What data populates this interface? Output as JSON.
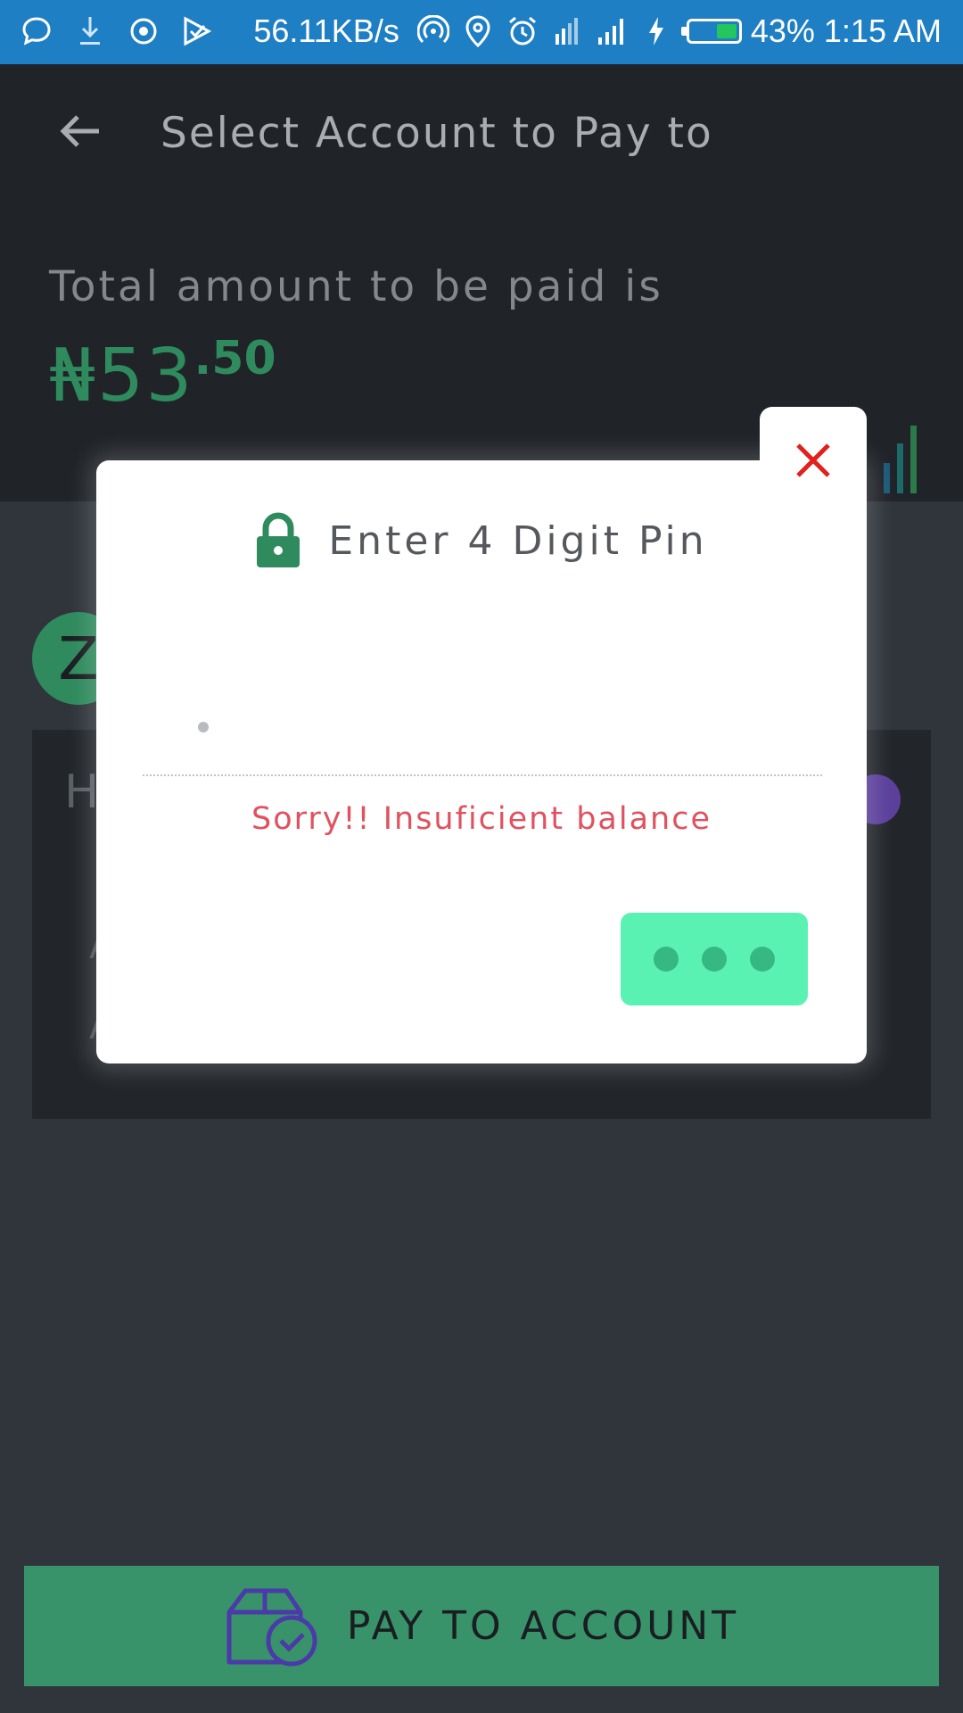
{
  "status_bar": {
    "speed": "56.11KB/s",
    "battery": "43%",
    "time": "1:15 AM",
    "battery_level": 0.43
  },
  "header": {
    "title": "Select Account to Pay to",
    "total_label": "Total amount to be paid is",
    "amount_main": "₦53",
    "amount_cents": ".50"
  },
  "background": {
    "avatar_letter": "Z",
    "card_initial": "H",
    "card_line1": "A",
    "card_line2": "A"
  },
  "modal": {
    "title": "Enter 4 Digit Pin",
    "error": "Sorry!! Insuficient balance"
  },
  "pay_button": {
    "label": "PAY TO ACCOUNT"
  },
  "colors": {
    "accent_green": "#38936a",
    "button_mint": "#5af2b3",
    "error_red": "#e0525f",
    "close_red": "#e0211c",
    "status_blue": "#1f7fc4"
  }
}
